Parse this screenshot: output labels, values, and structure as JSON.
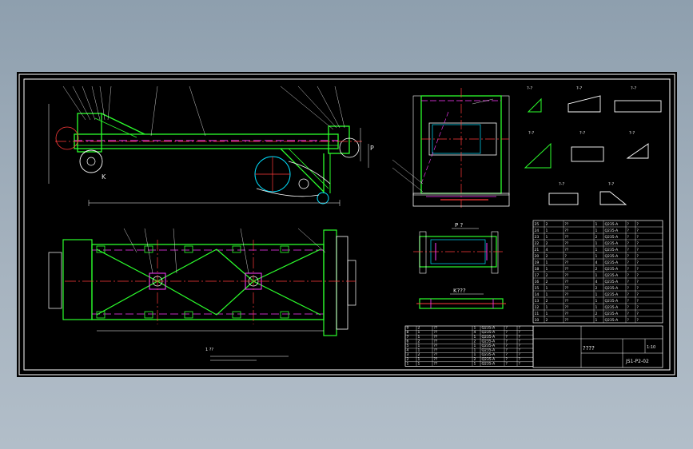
{
  "drawing": {
    "colors": {
      "frame": "#ffffff",
      "steel": "#2cff2c",
      "centerline": "#ff3b3b",
      "hidden": "#ff3bff",
      "detail": "#00e0ff",
      "leader": "#ffffff"
    },
    "labels": {
      "section_k": "K",
      "section_p": "P",
      "view_p": "P  ?",
      "view_k": "K???",
      "sheet_title": "????",
      "drawing_no": "JS1-P2-02",
      "scale": "1:10",
      "tech_req": "1   ??"
    },
    "parts_table_rows": [
      [
        "25",
        "2",
        "??",
        "1",
        "Q235-A",
        "?",
        "?"
      ],
      [
        "24",
        "1",
        "??",
        "1",
        "Q235-A",
        "?",
        "?"
      ],
      [
        "23",
        "1",
        "??",
        "2",
        "Q235-A",
        "?",
        "?"
      ],
      [
        "22",
        "2",
        "??",
        "1",
        "Q235-A",
        "?",
        "?"
      ],
      [
        "21",
        "4",
        "??",
        "1",
        "Q235-A",
        "?",
        "?"
      ],
      [
        "20",
        "2",
        "?",
        "1",
        "Q235-A",
        "?",
        "?"
      ],
      [
        "19",
        "1",
        "??",
        "4",
        "Q235-A",
        "?",
        "?"
      ],
      [
        "18",
        "1",
        "??",
        "2",
        "Q235-A",
        "?",
        "?"
      ],
      [
        "17",
        "2",
        "??",
        "1",
        "Q235-A",
        "?",
        "?"
      ],
      [
        "16",
        "2",
        "??",
        "4",
        "Q235-A",
        "?",
        "?"
      ],
      [
        "15",
        "1",
        "??",
        "2",
        "Q235-A",
        "?",
        "?"
      ],
      [
        "14",
        "1",
        "??",
        "1",
        "Q235-A",
        "?",
        "?"
      ],
      [
        "13",
        "2",
        "??",
        "1",
        "Q235-A",
        "?",
        "?"
      ],
      [
        "12",
        "1",
        "??",
        "1",
        "Q235-A",
        "?",
        "?"
      ],
      [
        "11",
        "1",
        "??",
        "2",
        "Q235-A",
        "?",
        "?"
      ],
      [
        "10",
        "2",
        "??",
        "1",
        "Q235-A",
        "?",
        "?"
      ]
    ],
    "lower_table_rows": [
      [
        "9",
        "2",
        "??",
        "1",
        "Q235-A",
        "?",
        "?"
      ],
      [
        "8",
        "1",
        "??",
        "4",
        "Q235-A",
        "?",
        "?"
      ],
      [
        "7",
        "1",
        "??",
        "1",
        "Q235-A",
        "?",
        "?"
      ],
      [
        "6",
        "2",
        "??",
        "2",
        "Q235-A",
        "?",
        "?"
      ],
      [
        "5",
        "1",
        "??",
        "1",
        "Q235-A",
        "?",
        "?"
      ],
      [
        "4",
        "1",
        "??",
        "1",
        "Q235-A",
        "?",
        "?"
      ],
      [
        "3",
        "2",
        "??",
        "1",
        "Q235-A",
        "?",
        "?"
      ],
      [
        "2",
        "1",
        "??",
        "2",
        "Q235-A",
        "?",
        "?"
      ],
      [
        "1",
        "1",
        "??",
        "1",
        "Q235-A",
        "?",
        "?"
      ]
    ],
    "detail_labels": [
      "?-?",
      "?-?",
      "?-?",
      "?-?",
      "?-?",
      "?-?",
      "?-?",
      "?-?"
    ]
  }
}
